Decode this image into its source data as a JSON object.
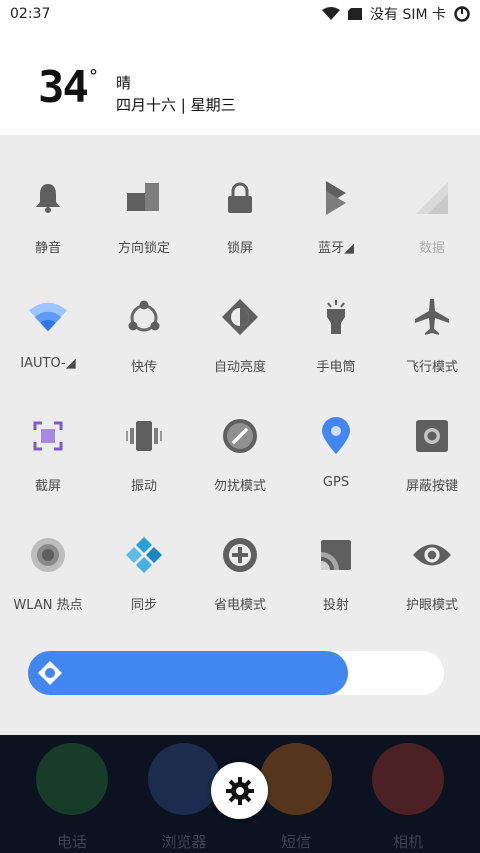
{
  "status_bar": {
    "time": "02:37",
    "carrier": "没有 SIM 卡"
  },
  "weather": {
    "temperature": "34",
    "degree": "°",
    "condition": "晴",
    "date": "四月十六 | 星期三"
  },
  "quick_tiles": [
    {
      "label": "静音",
      "icon": "bell-icon",
      "enabled": false
    },
    {
      "label": "方向锁定",
      "icon": "rotation-lock-icon",
      "enabled": false
    },
    {
      "label": "锁屏",
      "icon": "lock-icon",
      "enabled": false
    },
    {
      "label": "蓝牙◢",
      "icon": "bluetooth-icon",
      "enabled": false
    },
    {
      "label": "数据",
      "icon": "mobile-data-icon",
      "enabled": false
    },
    {
      "label": "IAUTO-◢",
      "icon": "wifi-icon",
      "enabled": true
    },
    {
      "label": "快传",
      "icon": "share-icon",
      "enabled": false
    },
    {
      "label": "自动亮度",
      "icon": "auto-brightness-icon",
      "enabled": false
    },
    {
      "label": "手电筒",
      "icon": "flashlight-icon",
      "enabled": false
    },
    {
      "label": "飞行模式",
      "icon": "airplane-icon",
      "enabled": false
    },
    {
      "label": "截屏",
      "icon": "screenshot-icon",
      "enabled": false
    },
    {
      "label": "振动",
      "icon": "vibrate-icon",
      "enabled": false
    },
    {
      "label": "勿扰模式",
      "icon": "do-not-disturb-icon",
      "enabled": false
    },
    {
      "label": "GPS",
      "icon": "gps-icon",
      "enabled": true
    },
    {
      "label": "屏蔽按键",
      "icon": "block-keys-icon",
      "enabled": false
    },
    {
      "label": "WLAN 热点",
      "icon": "hotspot-icon",
      "enabled": false
    },
    {
      "label": "同步",
      "icon": "sync-icon",
      "enabled": true
    },
    {
      "label": "省电模式",
      "icon": "battery-saver-icon",
      "enabled": false
    },
    {
      "label": "投射",
      "icon": "cast-icon",
      "enabled": false
    },
    {
      "label": "护眼模式",
      "icon": "eye-icon",
      "enabled": false
    }
  ],
  "brightness": {
    "level": 0.77,
    "fill_color": "#4286f0"
  },
  "dock": [
    {
      "label": "电话",
      "icon": "phone-icon",
      "color": "#2e8b3a"
    },
    {
      "label": "浏览器",
      "icon": "browser-icon",
      "color": "#3a5fa8"
    },
    {
      "label": "短信",
      "icon": "sms-icon",
      "color": "#e07b1a"
    },
    {
      "label": "相机",
      "icon": "camera-icon",
      "color": "#c7402d"
    }
  ],
  "settings_icon": "gear-icon",
  "colors": {
    "accent_blue": "#4286f0",
    "icon_grey": "#5f5f5f",
    "screenshot_purple": "#7a5cc7",
    "sync_cyan": "#2a9fd6"
  }
}
